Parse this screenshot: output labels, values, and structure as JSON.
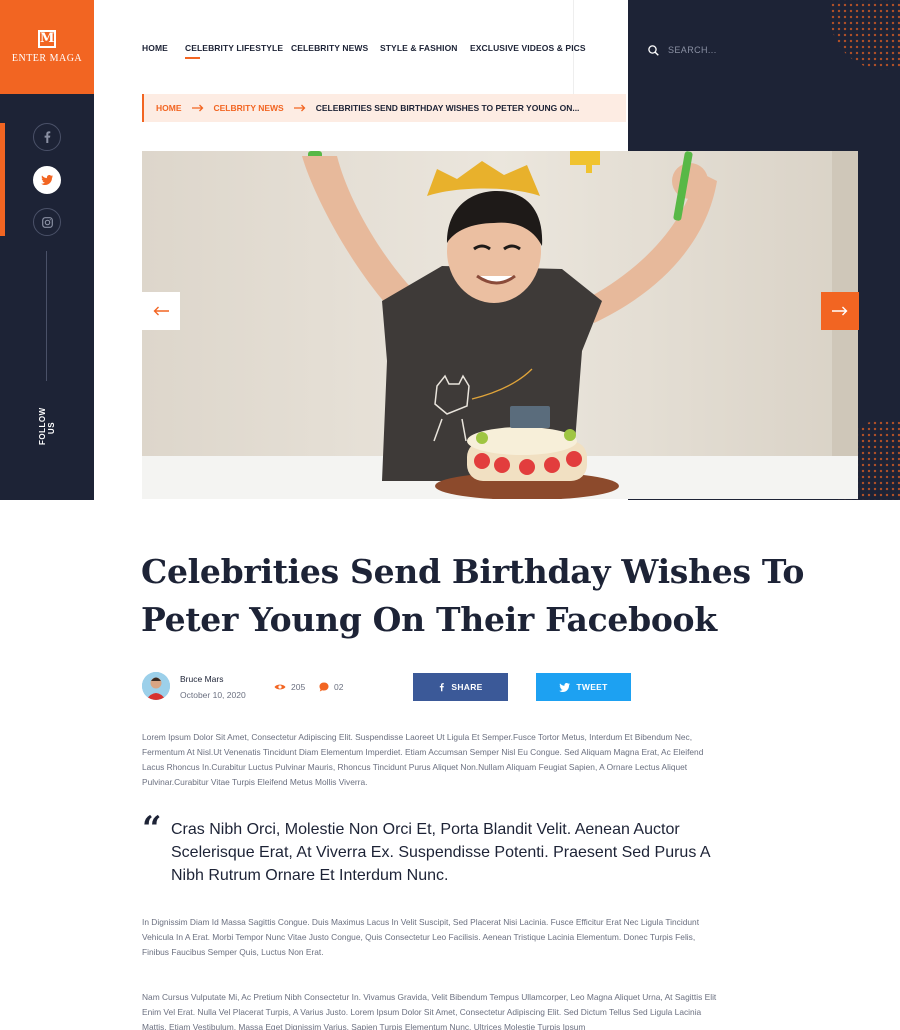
{
  "brand": {
    "logo_letter": "M",
    "name": "ENTER MAGA",
    "accent": "#f26522",
    "dark": "#1d2336"
  },
  "nav": {
    "items": [
      {
        "label": "HOME",
        "active": false
      },
      {
        "label": "CELEBRITY LIFESTYLE",
        "active": true
      },
      {
        "label": "CELEBRITY NEWS",
        "active": false
      },
      {
        "label": "STYLE & FASHION",
        "active": false
      },
      {
        "label": "EXCLUSIVE VIDEOS & PICS",
        "active": false
      }
    ]
  },
  "search": {
    "placeholder": "SEARCH..."
  },
  "social": {
    "follow_label": "FOLLOW US",
    "icons": [
      "facebook-icon",
      "twitter-icon",
      "instagram-icon"
    ]
  },
  "breadcrumb": {
    "home": "HOME",
    "section": "CELBRITY NEWS",
    "current": "CELEBRITIES SEND BIRTHDAY WISHES TO PETER YOUNG ON..."
  },
  "article": {
    "title": "Celebrities Send Birthday Wishes To Peter Young On Their Facebook",
    "author": "Bruce Mars",
    "date": "October 10, 2020",
    "views": "205",
    "comments": "02",
    "share_label": "SHARE",
    "tweet_label": "TWEET",
    "paragraph_1": "Lorem Ipsum Dolor Sit Amet, Consectetur Adipiscing Elit. Suspendisse Laoreet Ut Ligula Et Semper.Fusce Tortor Metus, Interdum Et Bibendum Nec, Fermentum At Nisl.Ut Venenatis Tincidunt Diam Elementum Imperdiet. Etiam Accumsan Semper Nisl Eu Congue. Sed Aliquam Magna Erat, Ac Eleifend Lacus Rhoncus In.Curabitur Luctus Pulvinar Mauris, Rhoncus Tincidunt Purus Aliquet Non.Nullam Aliquam Feugiat Sapien, A Ornare Lectus Aliquet Pulvinar.Curabitur Vitae Turpis Eleifend Metus Mollis Viverra.",
    "quote": "Cras Nibh Orci, Molestie Non Orci Et, Porta Blandit Velit. Aenean Auctor Scelerisque Erat, At Viverra Ex. Suspendisse Potenti. Praesent Sed Purus A Nibh Rutrum Ornare Et Interdum Nunc.",
    "paragraph_2": "In Dignissim Diam Id Massa Sagittis Congue. Duis Maximus Lacus In Velit Suscipit, Sed Placerat Nisi Lacinia. Fusce Efficitur Erat Nec Ligula Tincidunt Vehicula In A Erat. Morbi Tempor Nunc Vitae Justo Congue, Quis Consectetur Leo Facilisis. Aenean Tristique Lacinia Elementum. Donec Turpis Felis, Finibus Faucibus Semper Quis, Luctus Non Erat.",
    "paragraph_3": "Nam Cursus Vulputate Mi, Ac Pretium Nibh Consectetur In. Vivamus Gravida, Velit Bibendum Tempus Ullamcorper, Leo Magna Aliquet Urna, At Sagittis Elit Enim Vel Erat. Nulla Vel Placerat Turpis, A Varius Justo.    Lorem Ipsum Dolor Sit Amet, Consectetur Adipiscing Elit. Sed Dictum Tellus Sed Ligula Lacinia Mattis. Etiam Vestibulum, Massa Eget Dignissim Varius, Sapien Turpis Elementum Nunc, Ultrices Molestie Turpis Ipsum"
  }
}
